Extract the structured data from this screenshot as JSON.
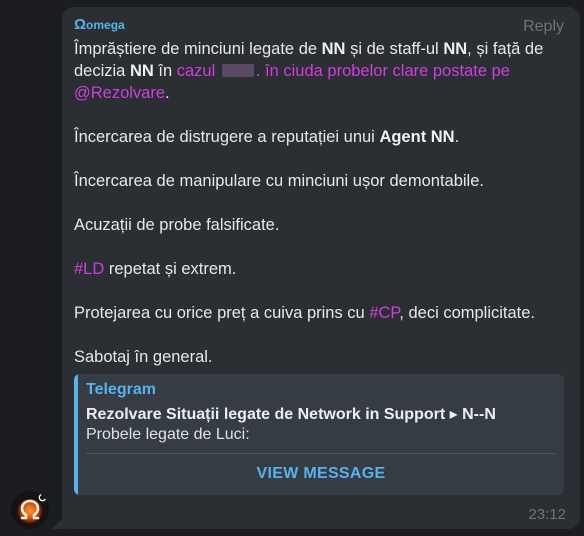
{
  "message": {
    "sender_glyph": "Ω",
    "sender_name": "omega",
    "reply_label": "Reply",
    "time": "23:12",
    "p1": {
      "t1": "Împrăștiere de minciuni legate de ",
      "b1": "NN",
      "t2": " și de staff-ul ",
      "b2": "NN",
      "t3": ", și față de decizia ",
      "b3": "NN",
      "t4": " în ",
      "link1": "cazul",
      "link2": ". în ciuda probelor clare postate pe @Rezolvare",
      "t5": "."
    },
    "p2": {
      "t1": "Încercarea de distrugere a reputației unui ",
      "b1": "Agent NN",
      "t2": "."
    },
    "p3": "Încercarea de manipulare cu minciuni ușor demontabile.",
    "p4": "Acuzații de probe falsificate.",
    "p5": {
      "tag": "#LD",
      "t1": " repetat și extrem."
    },
    "p6": {
      "t1": "Protejarea cu orice preț a cuiva prins cu ",
      "tag": "#CP",
      "t2": ", deci complicitate."
    },
    "p7": "Sabotaj în general."
  },
  "preview": {
    "site": "Telegram",
    "title": "Rezolvare Situații legate de Network in Support ▸ N--N",
    "description": "Probele legate de Luci:",
    "button": "VIEW MESSAGE"
  },
  "colors": {
    "background": "#1b1d21",
    "bubble": "#2b2e33",
    "accent": "#55b3ea",
    "hashtag": "#cf3fe0"
  }
}
